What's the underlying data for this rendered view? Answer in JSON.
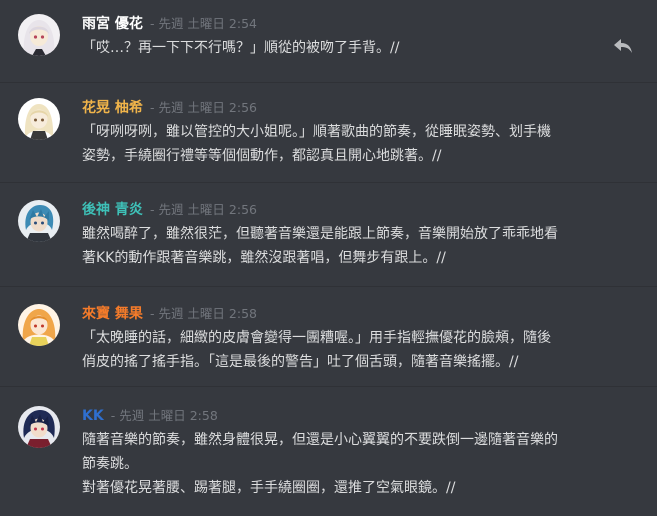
{
  "messages": [
    {
      "author": "雨宮 優花",
      "author_color": "#ffffff",
      "meta": "- 先週 土曜日 2:54",
      "lines": [
        "「哎…？再一下下不行嗎？」順從的被吻了手背。//"
      ],
      "avatar_icon": "white-hair-girl-avatar",
      "avatar_colors": {
        "hair": "#e8e4ea",
        "skin": "#f6ead8",
        "eyes": "#b7465a",
        "bg": "#f2f0f3"
      }
    },
    {
      "author": "花晃 柚希",
      "author_color": "#f0b44a",
      "meta": "- 先週 土曜日 2:56",
      "lines": [
        "「呀咧呀咧，雖以管控的大小姐呢。」順著歌曲的節奏，從睡眠姿勢、划手機",
        "姿勢，手繞圈行禮等等個個動作，都認真且開心地跳著。//"
      ],
      "avatar_icon": "blonde-girl-avatar",
      "avatar_colors": {
        "hair": "#efe3c1",
        "skin": "#f7ecdc",
        "eyes": "#7a5a3a",
        "bg": "#ffffff"
      }
    },
    {
      "author": "後神 青炎",
      "author_color": "#3ec1b8",
      "meta": "- 先週 土曜日 2:56",
      "lines": [
        "雖然喝醉了，雖然很茫，但聽著音樂還是能跟上節奏，音樂開始放了乖乖地看",
        "著KK的動作跟著音樂跳，雖然沒跟著唱，但舞步有跟上。//"
      ],
      "avatar_icon": "blue-hair-boy-avatar",
      "avatar_colors": {
        "hair": "#3d8bb5",
        "skin": "#efdccb",
        "eyes": "#2b4d7a",
        "bg": "#e9eef2"
      }
    },
    {
      "author": "來寶 舞果",
      "author_color": "#f47b2a",
      "meta": "- 先週 土曜日 2:58",
      "lines": [
        "「太晚睡的話，細緻的皮膚會變得一團糟喔。」用手指輕撫優花的臉頰，隨後",
        "俏皮的搖了搖手指。「這是最後的警告」吐了個舌頭，隨著音樂搖擺。//"
      ],
      "avatar_icon": "orange-hair-girl-avatar",
      "avatar_colors": {
        "hair": "#f0a64a",
        "skin": "#fbe6d2",
        "eyes": "#c0392b",
        "bg": "#fff4e6"
      }
    },
    {
      "author": "KK",
      "author_color": "#2f6fcf",
      "meta": "- 先週 土曜日 2:58",
      "lines": [
        "隨著音樂的節奏，雖然身體很晃，但還是小心翼翼的不要跌倒一邊隨著音樂的",
        "節奏跳。",
        "對著優花晃著腰、踢著腿，手手繞圈圈，還推了空氣眼鏡。//"
      ],
      "avatar_icon": "dark-hair-boy-avatar",
      "avatar_colors": {
        "hair": "#1f2a55",
        "skin": "#f1dccb",
        "eyes": "#c2334b",
        "bg": "#e7e9ef"
      }
    }
  ],
  "reply_icon": "reply-arrow-icon"
}
